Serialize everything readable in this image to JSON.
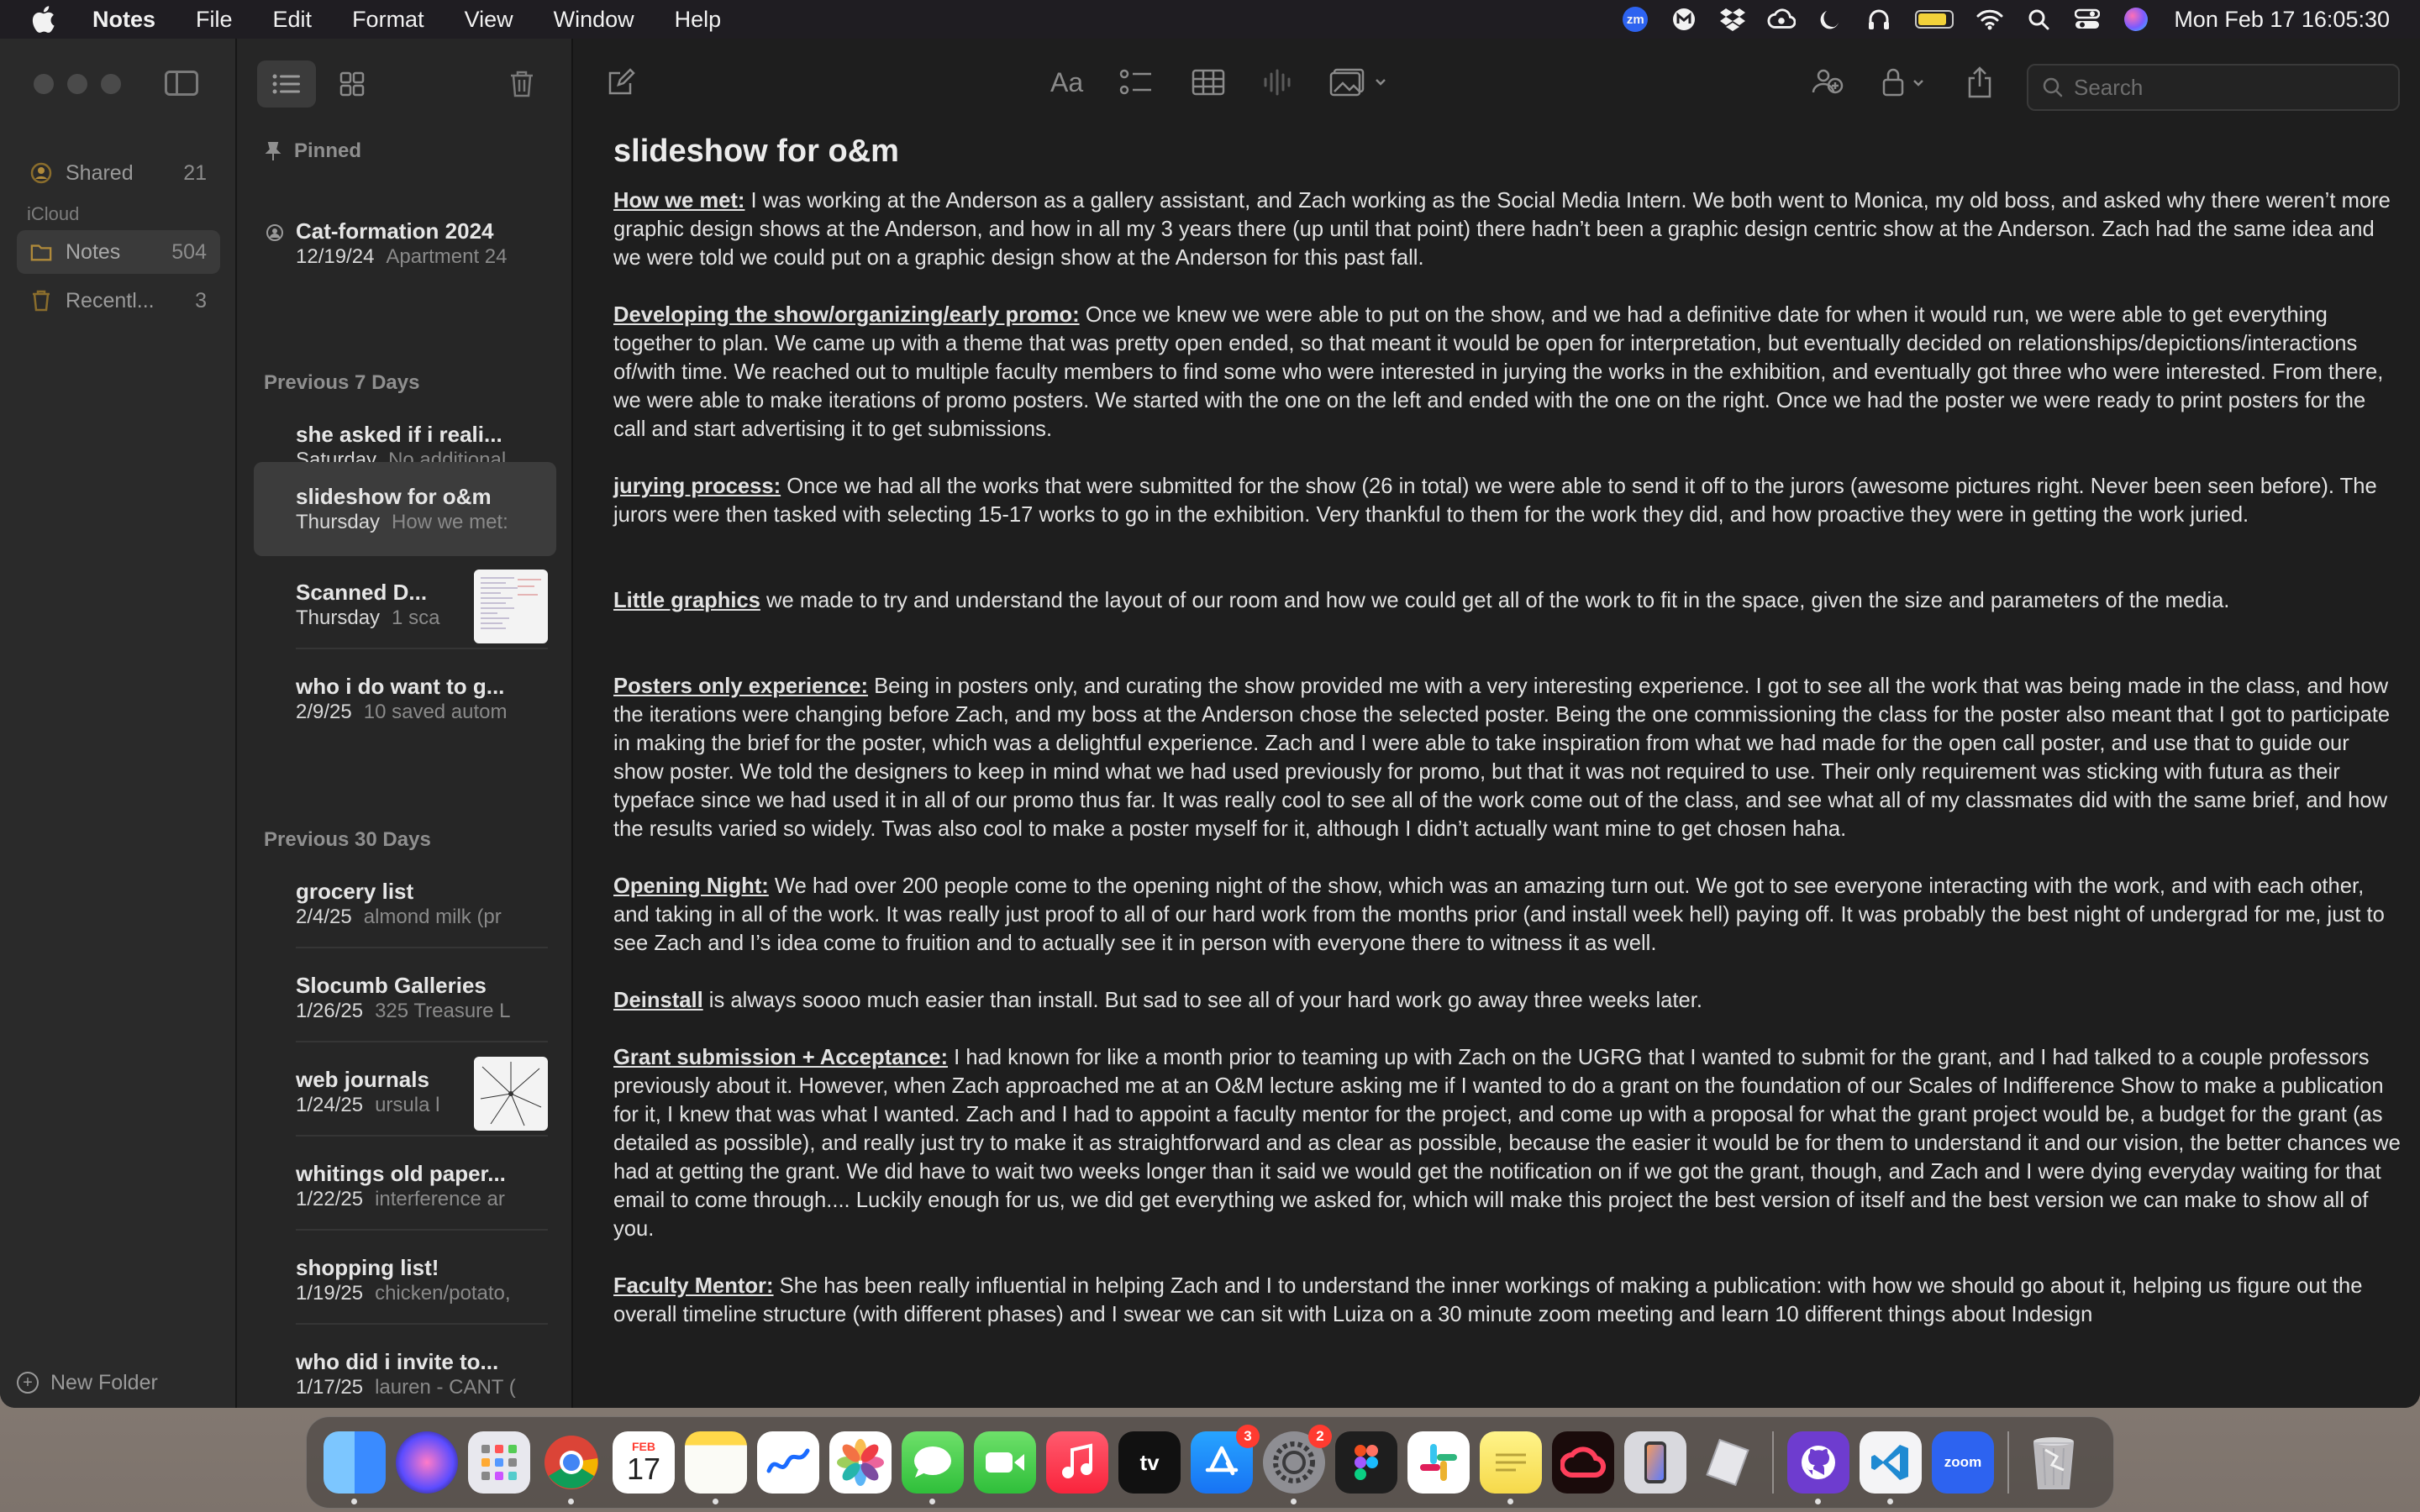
{
  "menubar": {
    "items": [
      "Notes",
      "File",
      "Edit",
      "Format",
      "View",
      "Window",
      "Help"
    ],
    "zoom_label": "zm",
    "clock": "Mon Feb 17  16:05:30"
  },
  "sidebar": {
    "shared_label": "Shared",
    "shared_count": "21",
    "section": "iCloud",
    "notes_label": "Notes",
    "notes_count": "504",
    "recent_label": "Recentl...",
    "recent_count": "3",
    "new_folder": "New Folder"
  },
  "notelist": {
    "pinned_header": "Pinned",
    "prev7_header": "Previous 7 Days",
    "prev30_header": "Previous 30 Days",
    "notes": [
      {
        "title": "Cat-formation 2024",
        "date": "12/19/24",
        "preview": "Apartment 24"
      },
      {
        "title": "she asked if i reali...",
        "date": "Saturday",
        "preview": "No additional"
      },
      {
        "title": "slideshow for o&m",
        "date": "Thursday",
        "preview": "How we met:"
      },
      {
        "title": "Scanned D...",
        "date": "Thursday",
        "preview": "1 sca"
      },
      {
        "title": "who i do want to g...",
        "date": "2/9/25",
        "preview": "10 saved autom"
      },
      {
        "title": "grocery list",
        "date": "2/4/25",
        "preview": "almond milk (pr"
      },
      {
        "title": "Slocumb Galleries",
        "date": "1/26/25",
        "preview": "325 Treasure L"
      },
      {
        "title": "web journals",
        "date": "1/24/25",
        "preview": "ursula l"
      },
      {
        "title": "whitings old paper...",
        "date": "1/22/25",
        "preview": "interference ar"
      },
      {
        "title": "shopping list!",
        "date": "1/19/25",
        "preview": "chicken/potato,"
      },
      {
        "title": "who did i invite to...",
        "date": "1/17/25",
        "preview": "lauren - CANT ("
      }
    ]
  },
  "editor": {
    "search_placeholder": "Search",
    "format_label": "Aa",
    "title": "slideshow for o&m",
    "paragraphs": [
      {
        "head": "How we met:",
        "text": " I was working at the Anderson as a gallery assistant, and Zach working as the Social Media Intern. We both went to Monica, my old boss, and asked why there weren’t more graphic design shows at the Anderson, and how in all my 3 years there (up until that point) there hadn’t been a graphic design centric show at the Anderson. Zach had the same idea and we were told we could put on a graphic design show at the Anderson for this past fall."
      },
      {
        "head": "Developing the show/organizing/early promo:",
        "text": " Once we knew we were able to put on the show, and we had a definitive date for when it would run, we were able to get everything together to plan. We came up with a theme that was pretty open ended, so that meant it would be open for interpretation, but eventually decided on relationships/depictions/interactions of/with time. We reached out to multiple faculty members to find some who were interested in jurying the works in the exhibition, and eventually got three who were interested. From there, we were able to make iterations of promo posters. We started with the one on the left and ended with the one on the right. Once we had the poster we were ready to print posters for the call and start advertising it to get submissions."
      },
      {
        "head": "jurying process:",
        "text": " Once we had all the works that were submitted for the show (26 in total) we were able to send it off to the jurors (awesome pictures right. Never been seen before). The jurors were then tasked with selecting 15-17 works to go in the exhibition. Very thankful to them for the work they did, and how proactive they were in getting the work juried."
      },
      {
        "head": "Little graphics",
        "text": " we made to try and understand the layout of our room and how we could get all of the work to fit in the space, given the size and parameters of the media."
      },
      {
        "head": "Posters only experience:",
        "text": " Being in posters only, and curating the show provided me with a very interesting experience. I got to see all the work that was being made in the class, and how the iterations were changing before Zach, and my boss at the Anderson chose the selected poster. Being the one commissioning the class for the poster also meant that I got to participate in making the brief for the poster, which was a delightful experience. Zach and I were able to take inspiration from what we had made for the open call poster, and use that to guide our show poster. We told the designers to keep in mind what we had used previously for promo, but that it was not required to use. Their only requirement was sticking with futura as their typeface since we had used it in all of our promo thus far. It was really cool to see all of the work come out of the class, and see what all of my classmates did with the same brief, and how the results varied so widely. Twas also cool to make a poster myself for it, although I didn’t actually want mine to get chosen haha."
      },
      {
        "head": "Opening Night:",
        "text": " We had over 200 people come to the opening night of the show, which was an amazing turn out. We got to see everyone interacting with the work, and with each other, and taking in all of the work. It was really just proof to all of our hard work from the months prior (and install week hell) paying off. It was probably the best night of undergrad for me, just to see Zach and I’s idea come to fruition and to actually see it in person with everyone there to witness it as well."
      },
      {
        "head": "Deinstall",
        "text": " is always soooo much easier than install. But sad to see all of your hard work go away three weeks later."
      },
      {
        "head": "Grant submission + Acceptance:",
        "text": " I had known for like a month prior to teaming up with Zach on the UGRG that I wanted to submit for the grant, and I had talked to a couple professors previously about it. However, when Zach approached me at an O&M lecture asking me if I wanted to do a grant on the foundation of our Scales of Indifference Show to make a publication for it, I knew that was what I wanted. Zach and I had to appoint a faculty mentor for the project, and come up with a proposal for what the grant project would be, a budget for the grant (as detailed as possible), and really just try to make it as straightforward and as clear as possible, because the easier it would be for them to understand it and our vision, the better chances we had at getting the grant. We did have to wait two weeks longer than it said we would get the notification on if we got the grant, though, and Zach and I were dying everyday waiting for that email to come through.... Luckily enough for us, we did get everything we asked for, which will make this project the best version of itself and the best version we can make to show all of you."
      },
      {
        "head": "Faculty Mentor:",
        "text": " She has been really influential in helping Zach and I to understand the inner workings of making a publication: with how we should go about it, helping us figure out the overall timeline structure (with different phases) and I swear we can sit with Luiza on a 30 minute zoom meeting and learn 10 different things about Indesign"
      }
    ]
  },
  "dock": {
    "calendar_month": "FEB",
    "calendar_day": "17",
    "appstore_badge": "3",
    "settings_badge": "2",
    "tv_label": "tv",
    "zoom_label": "zoom"
  }
}
